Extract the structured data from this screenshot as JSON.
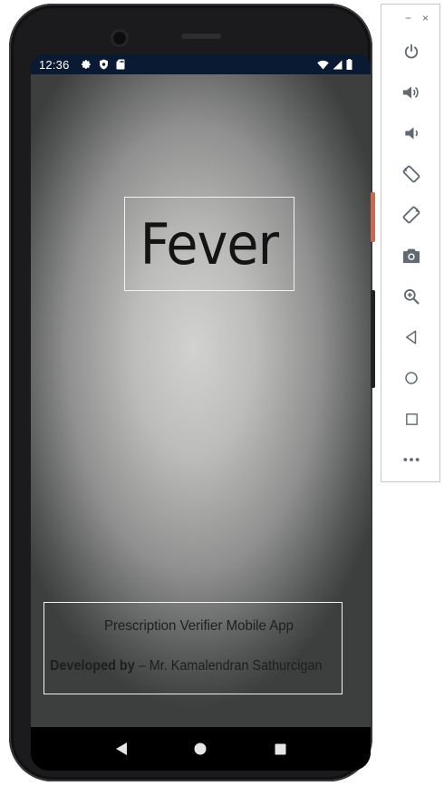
{
  "status_bar": {
    "time": "12:36",
    "left_icons": [
      "gear-icon",
      "shield-icon",
      "sd-card-icon"
    ],
    "right_icons": [
      "wifi-icon",
      "signal-icon",
      "battery-icon"
    ]
  },
  "app": {
    "title": "Fever",
    "app_name": "Prescription Verifier Mobile App",
    "developer_label": "Developed by",
    "developer_name": " – Mr. Kamalendran Sathurcigan"
  },
  "nav_bar": {
    "buttons": [
      "back-icon",
      "home-icon",
      "recents-icon"
    ]
  },
  "emulator_toolbar": {
    "minimize": "−",
    "close": "×",
    "tools": [
      "power-icon",
      "volume-up-icon",
      "volume-down-icon",
      "rotate-left-icon",
      "rotate-right-icon",
      "camera-icon",
      "zoom-icon",
      "back-icon",
      "home-icon",
      "overview-icon",
      "more-icon"
    ]
  },
  "colors": {
    "status_bar_bg": "#0b1a33",
    "toolbar_icon": "#5f6a73",
    "box_border": "#f2f2f2",
    "side_button_accent": "#c9694f"
  }
}
